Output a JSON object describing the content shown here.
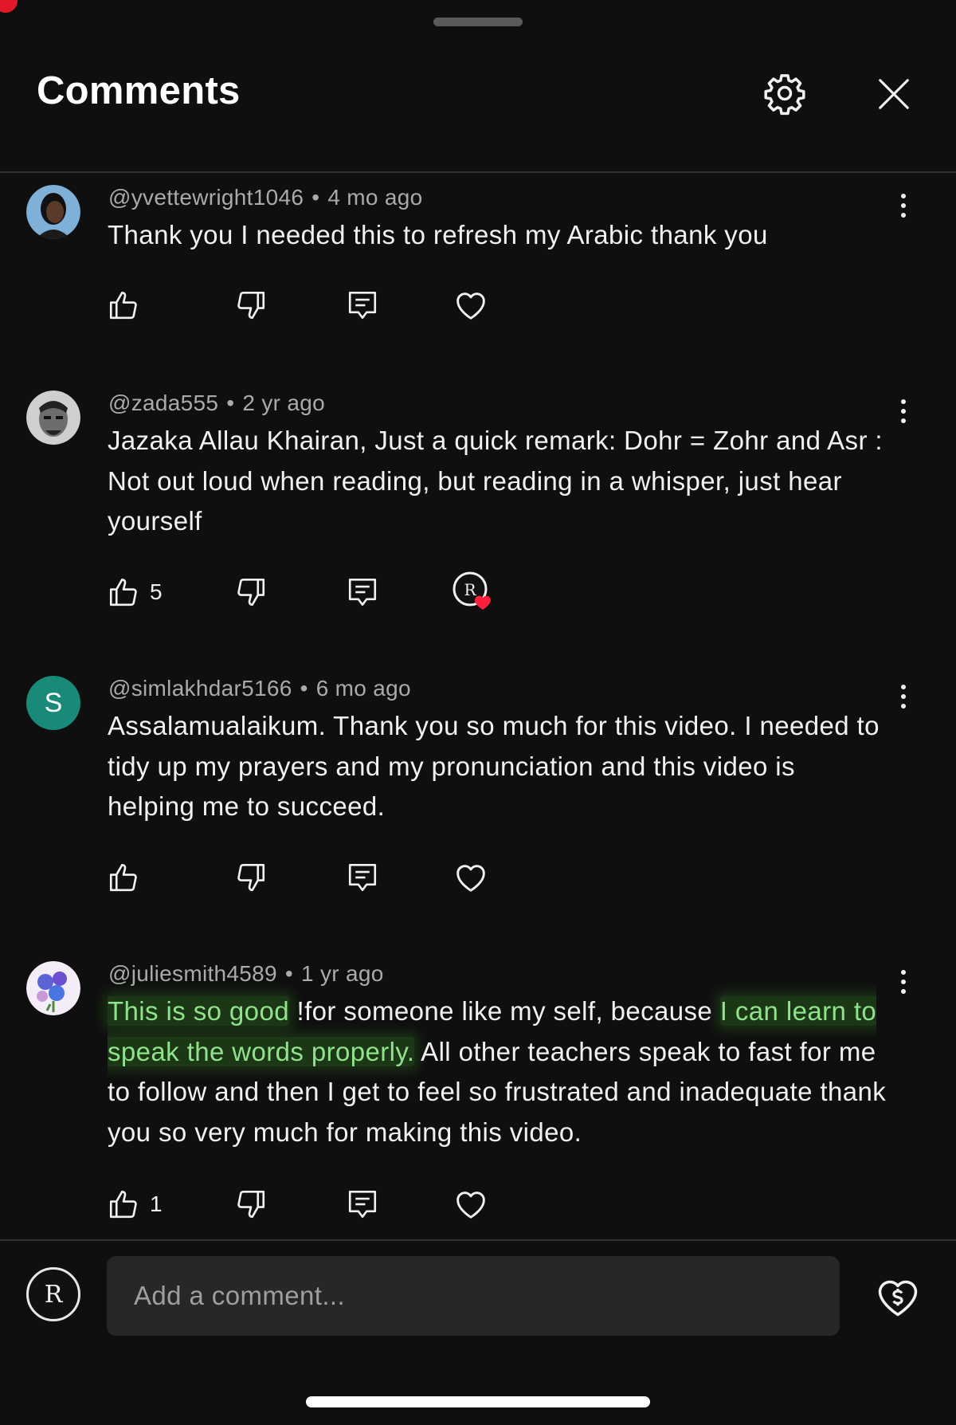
{
  "header": {
    "title": "Comments",
    "settings_icon": "gear-icon",
    "close_icon": "close-icon"
  },
  "colors": {
    "background": "#0f0f0f",
    "text": "#f1f1f1",
    "meta": "#aaaaaa",
    "annotation_red": "#e8213a",
    "highlight_green": "#8fe38a",
    "avatar_s": "#1a8a78"
  },
  "comments": [
    {
      "author": "@yvettewright1046",
      "time": "4 mo ago",
      "text": "Thank you I needed this to refresh my Arabic thank you",
      "likes": "",
      "liked_by_creator": false
    },
    {
      "author": "@zada555",
      "time": "2 yr ago",
      "text": "Jazaka Allau Khairan, Just a quick remark: Dohr = Zohr and Asr : Not out loud when reading, but reading in a whisper, just hear yourself",
      "likes": "5",
      "liked_by_creator": true
    },
    {
      "author": "@simlakhdar5166",
      "time": "6 mo ago",
      "avatar_letter": "S",
      "text": "Assalamualaikum. Thank you so much for this video. I needed to tidy up my prayers and my pronunciation and this video is helping me to succeed.",
      "likes": "",
      "liked_by_creator": false
    },
    {
      "author": "@juliesmith4589",
      "time": "1 yr ago",
      "text_parts": {
        "p1": "This is so good",
        "p2": " !for someone  like my  self, because ",
        "p3": "I can learn to speak the words properly.",
        "p4": " All other teachers speak to fast for me to follow and then I get to feel so frustrated and inadequate thank you so very much for making this video."
      },
      "likes": "1",
      "liked_by_creator": false
    }
  ],
  "composer": {
    "placeholder": "Add a comment...",
    "donate_icon": "heart-dollar-icon"
  }
}
